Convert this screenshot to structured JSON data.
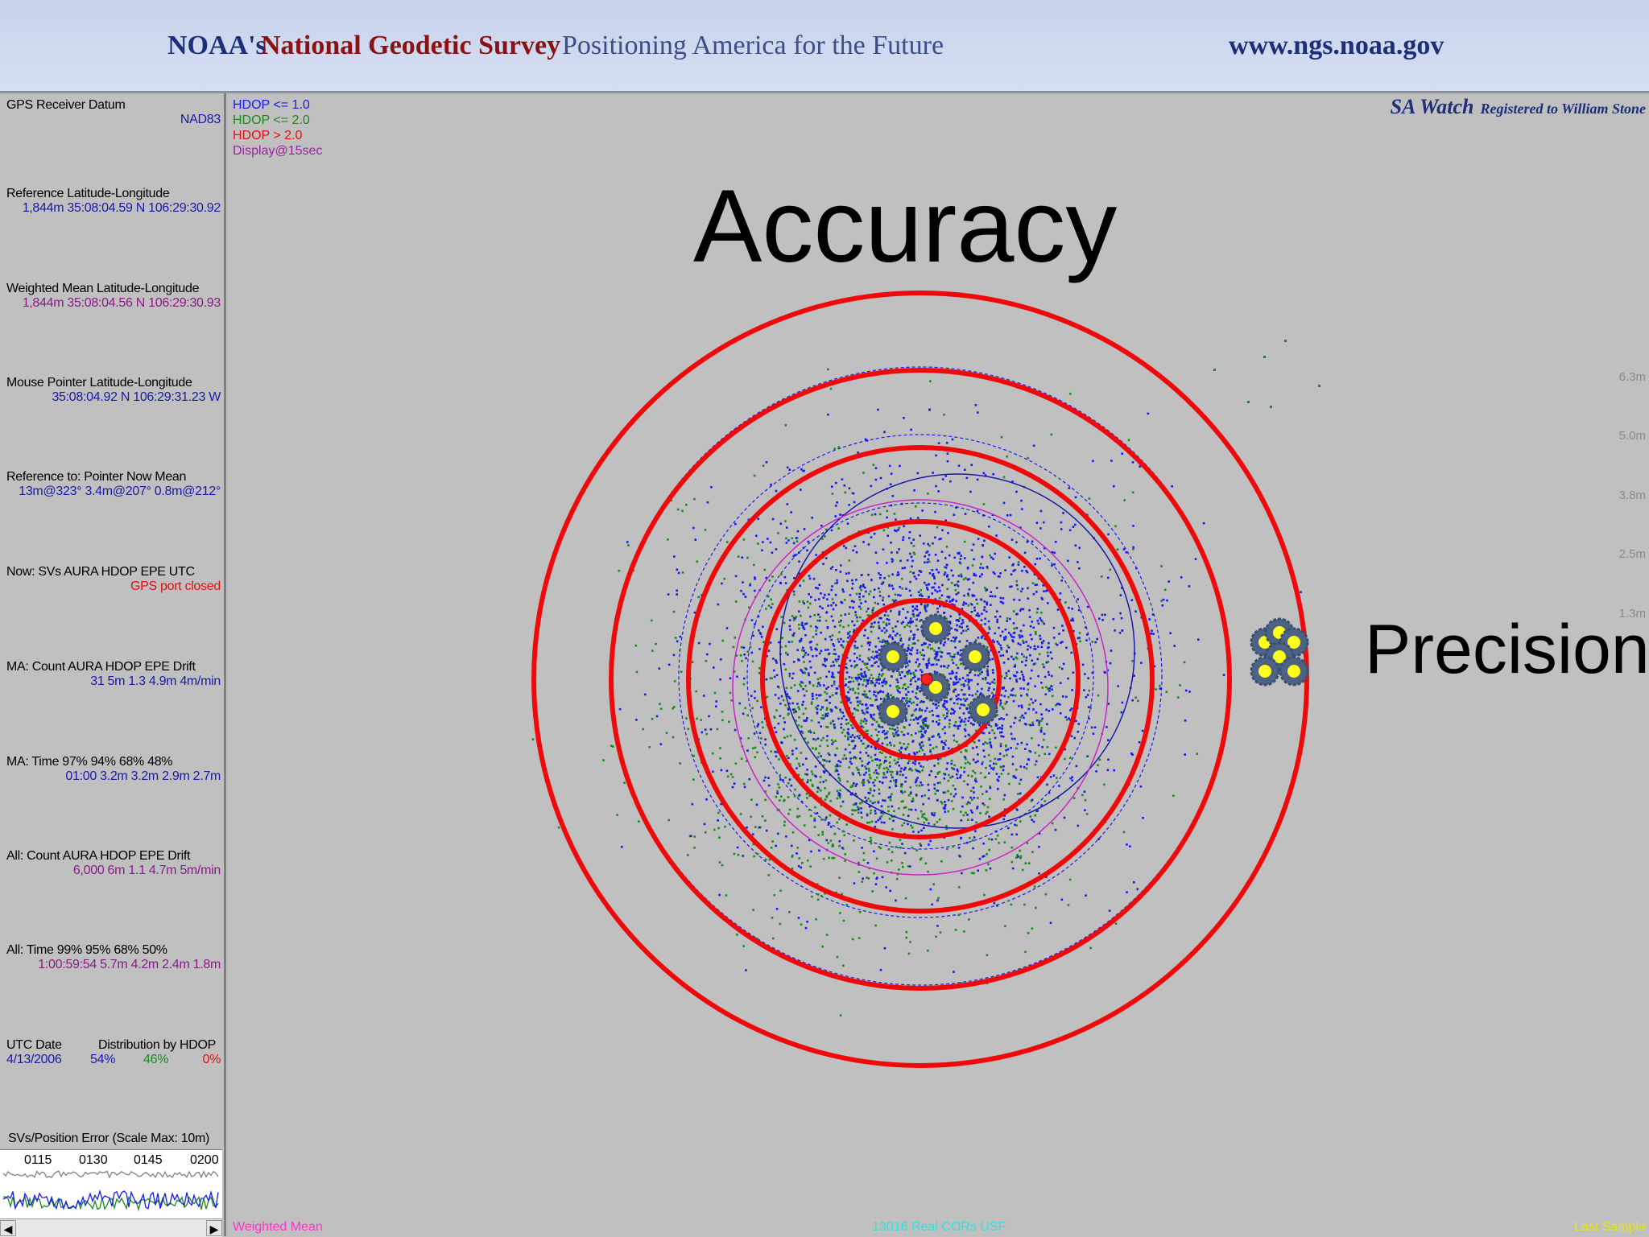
{
  "banner": {
    "noaa": "NOAA's",
    "ngs": "National Geodetic Survey",
    "tagline": "Positioning America for the Future",
    "url": "www.ngs.noaa.gov"
  },
  "left": {
    "datum": {
      "label": "GPS Receiver Datum",
      "value": "NAD83"
    },
    "ref": {
      "label": "Reference Latitude-Longitude",
      "value": "1,844m 35:08:04.59 N  106:29:30.92"
    },
    "wmean": {
      "label": "Weighted Mean Latitude-Longitude",
      "value": "1,844m 35:08:04.56 N  106:29:30.93"
    },
    "mouse": {
      "label": "Mouse Pointer Latitude-Longitude",
      "value": "35:08:04.92 N  106:29:31.23 W"
    },
    "refto": {
      "label": "Reference to:   Pointer   Now   Mean",
      "value": "13m@323°  3.4m@207°  0.8m@212°"
    },
    "now": {
      "label": "Now:  SVs  AURA  HDOP  EPE  UTC",
      "value": "GPS port closed"
    },
    "ma1": {
      "label": "MA:  Count  AURA  HDOP  EPE  Drift",
      "value": "31   5m  1.3  4.9m  4m/min"
    },
    "ma2": {
      "label": "MA:   Time     97%   94%   68%   48%",
      "value": "01:00  3.2m  3.2m  2.9m  2.7m"
    },
    "all1": {
      "label": "All:   Count  AURA  HDOP  EPE  Drift",
      "value": "6,000   6m  1.1  4.7m  5m/min"
    },
    "all2": {
      "label": "All:    Time      99%   95%   68%   50%",
      "value": "1:00:59:54  5.7m  4.2m  2.4m  1.8m"
    },
    "utc": {
      "label": "UTC Date",
      "date": "4/13/2006"
    },
    "dist": {
      "label": "Distribution by HDOP",
      "p1": "54%",
      "p2": "46%",
      "p3": "0%"
    },
    "svs_label": "SVs/Position Error (Scale Max: 10m)",
    "ticks": [
      "0115",
      "0130",
      "0145",
      "0200"
    ]
  },
  "plot": {
    "legend": [
      "HDOP <= 1.0",
      "HDOP <= 2.0",
      "HDOP >  2.0",
      "Display@15sec"
    ],
    "sa_name": "SA Watch",
    "sa_reg": "Registered to William Stone",
    "accuracy": "Accuracy",
    "precision": "Precision",
    "scale": [
      "6.3m",
      "5.0m",
      "3.8m",
      "2.5m",
      "1.3m"
    ],
    "footer_left": "Weighted Mean",
    "footer_mid": "13016 Real CORs USF",
    "footer_right": "Last Sample"
  },
  "colors": {
    "hdop1": "#1a1aee",
    "hdop2": "#1a8a1a",
    "hdop3": "#e01010",
    "display": "#a020a0",
    "rings": "#ee0a0a"
  }
}
